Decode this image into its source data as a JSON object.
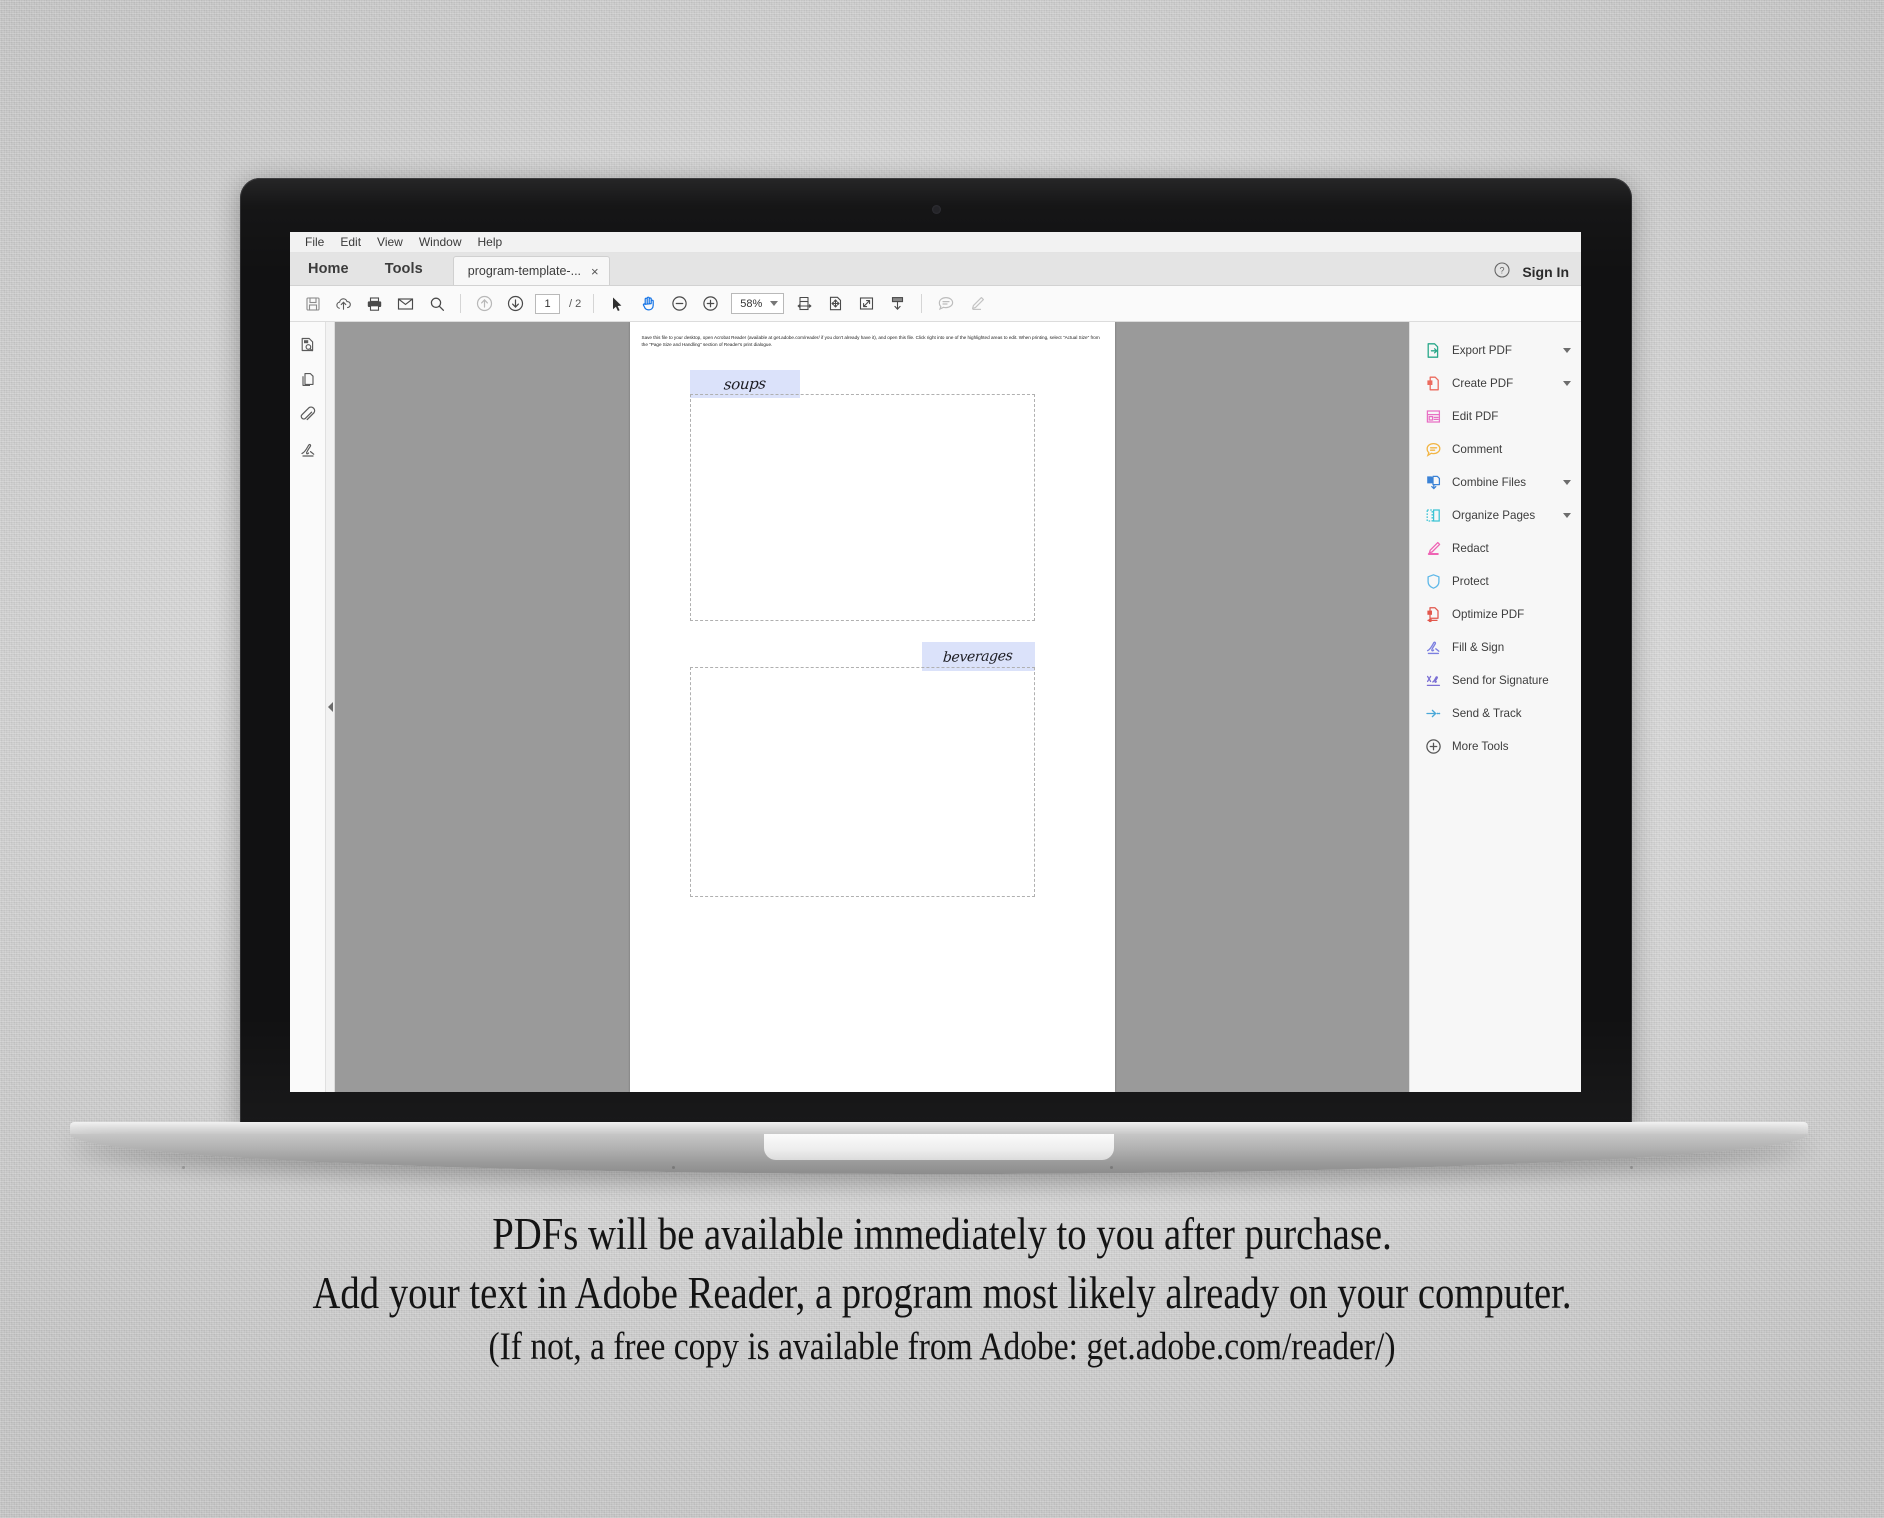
{
  "menubar": {
    "items": [
      {
        "label": "File"
      },
      {
        "label": "Edit"
      },
      {
        "label": "View"
      },
      {
        "label": "Window"
      },
      {
        "label": "Help"
      }
    ]
  },
  "tabbar": {
    "home_label": "Home",
    "tools_label": "Tools",
    "document_tab": {
      "label": "program-template-...",
      "close": "×"
    },
    "help_icon": "help-circle-icon",
    "signin_label": "Sign In"
  },
  "toolbar": {
    "save_icon": "save-icon",
    "upload_icon": "cloud-upload-icon",
    "print_icon": "print-icon",
    "email_icon": "email-icon",
    "search_icon": "search-icon",
    "prev_page_icon": "arrow-up-circle-icon",
    "next_page_icon": "arrow-down-circle-icon",
    "page_number": "1",
    "page_total": "/ 2",
    "select_icon": "cursor-arrow-icon",
    "hand_icon": "hand-tool-icon",
    "zoom_out_icon": "zoom-out-icon",
    "zoom_in_icon": "zoom-in-icon",
    "zoom_level": "58%",
    "fit_width_icon": "fit-width-icon",
    "fit_page_icon": "fit-page-icon",
    "fullscreen_icon": "fullscreen-icon",
    "scroll_mode_icon": "scroll-down-icon",
    "comment_icon": "comment-bubble-icon",
    "highlight_icon": "highlighter-pen-icon"
  },
  "leftrail": {
    "items": [
      {
        "name": "page-thumbnails-icon"
      },
      {
        "name": "page-copies-icon"
      },
      {
        "name": "attachment-paperclip-icon"
      },
      {
        "name": "signature-pen-icon"
      }
    ],
    "collapse_icon": "collapse-left-icon"
  },
  "document": {
    "instructions": "Save this file to your desktop, open Acrobat Reader (available at get.adobe.com/reader/ if you don't already have it), and open this file.  Click right into one of the highlighted areas to edit. When printing, select \"Actual Size\" from the \"Page Size and Handling\" section of Reader's print dialogue.",
    "sections": [
      {
        "heading": "soups"
      },
      {
        "heading": "beverages"
      }
    ],
    "highlight_color": "#dbe2fa"
  },
  "toolspanel": {
    "items": [
      {
        "label": "Export PDF",
        "icon": "export-pdf-icon",
        "color": "#2aa88a",
        "caret": true
      },
      {
        "label": "Create PDF",
        "icon": "create-pdf-icon",
        "color": "#ec6b5e",
        "caret": true
      },
      {
        "label": "Edit PDF",
        "icon": "edit-pdf-icon",
        "color": "#e86fc4",
        "caret": false
      },
      {
        "label": "Comment",
        "icon": "comment-icon",
        "color": "#f2b544",
        "caret": false
      },
      {
        "label": "Combine Files",
        "icon": "combine-files-icon",
        "color": "#3b82d6",
        "caret": true
      },
      {
        "label": "Organize Pages",
        "icon": "organize-pages-icon",
        "color": "#3cc4d4",
        "caret": true
      },
      {
        "label": "Redact",
        "icon": "redact-icon",
        "color": "#ef63b4",
        "caret": false
      },
      {
        "label": "Protect",
        "icon": "protect-icon",
        "color": "#5fb8e8",
        "caret": false
      },
      {
        "label": "Optimize PDF",
        "icon": "optimize-pdf-icon",
        "color": "#e2574c",
        "caret": false
      },
      {
        "label": "Fill & Sign",
        "icon": "fill-and-sign-icon",
        "color": "#7b7fe0",
        "caret": false
      },
      {
        "label": "Send for Signature",
        "icon": "send-for-signature-icon",
        "color": "#7b6fd4",
        "caret": false
      },
      {
        "label": "Send & Track",
        "icon": "send-and-track-icon",
        "color": "#4aa8d8",
        "caret": false
      },
      {
        "label": "More Tools",
        "icon": "more-tools-icon",
        "color": "#555555",
        "caret": false
      }
    ]
  },
  "caption": {
    "line1": "PDFs will be available immediately to you after purchase.",
    "line2": "Add your text in Adobe Reader, a program most likely already on your computer.",
    "line3": "(If not, a free copy is available from Adobe: get.adobe.com/reader/)"
  }
}
